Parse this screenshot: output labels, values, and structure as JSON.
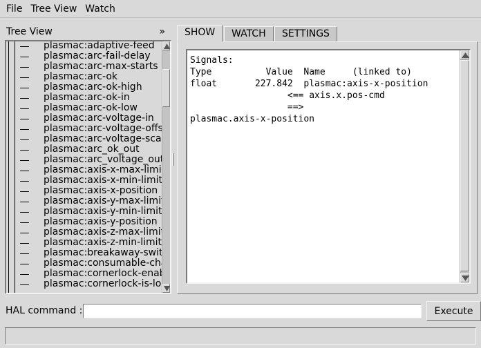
{
  "menu": [
    {
      "label": "File"
    },
    {
      "label": "Tree View"
    },
    {
      "label": "Watch"
    }
  ],
  "tree": {
    "title": "Tree View",
    "collapse_label": "»",
    "items": [
      "plasmac:adaptive-feed",
      "plasmac:arc-fail-delay",
      "plasmac:arc-max-starts",
      "plasmac:arc-ok",
      "plasmac:arc-ok-high",
      "plasmac:arc-ok-in",
      "plasmac:arc-ok-low",
      "plasmac:arc-voltage-in",
      "plasmac:arc-voltage-offse",
      "plasmac:arc-voltage-scal",
      "plasmac:arc_ok_out",
      "plasmac:arc_voltage_out",
      "plasmac:axis-x-max-limit",
      "plasmac:axis-x-min-limit",
      "plasmac:axis-x-position",
      "plasmac:axis-y-max-limit",
      "plasmac:axis-y-min-limit",
      "plasmac:axis-y-position",
      "plasmac:axis-z-max-limit",
      "plasmac:axis-z-min-limit",
      "plasmac:breakaway-swit",
      "plasmac:consumable-cha",
      "plasmac:cornerlock-enab",
      "plasmac:cornerlock-is-loc"
    ]
  },
  "tabs": [
    {
      "label": "SHOW",
      "active": true
    },
    {
      "label": "WATCH",
      "active": false
    },
    {
      "label": "SETTINGS",
      "active": false
    }
  ],
  "show": {
    "heading": "Signals:",
    "col_type": "Type",
    "col_value": "Value",
    "col_name": "Name",
    "col_linked": "(linked to)",
    "type": "float",
    "value": "227.842",
    "name": "plasmac:axis-x-position",
    "input_arrow": "<==",
    "input_link": "axis.x.pos-cmd",
    "output_arrow": "==>",
    "output_link": "plasmac.axis-x-position"
  },
  "command": {
    "label": "HAL command :",
    "value": "",
    "placeholder": "",
    "execute_label": "Execute"
  },
  "status": {
    "text": ""
  }
}
